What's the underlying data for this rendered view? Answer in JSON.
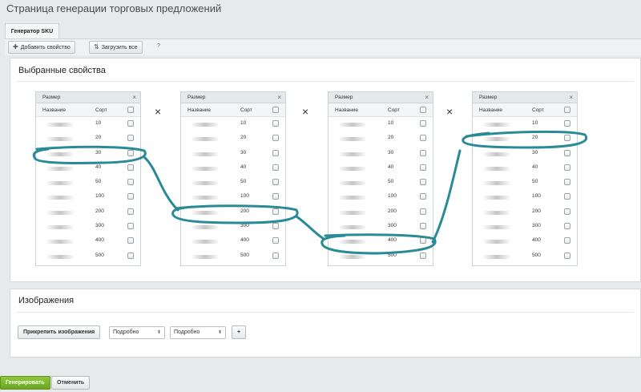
{
  "page_title": "Страница генерации торговых предложений",
  "tab_label": "Генератор SKU",
  "toolbar": {
    "add_label": "Добавить свойство",
    "load_label": "Загрузить все",
    "help_label": "?"
  },
  "selected": {
    "title": "Выбранные свойства"
  },
  "properties": [
    {
      "header": "Размер",
      "col_name": "Название",
      "col_sort": "Сорт",
      "values": [
        "10",
        "20",
        "30",
        "40",
        "50",
        "100",
        "200",
        "300",
        "400",
        "500"
      ]
    },
    {
      "header": "Размер",
      "col_name": "Название",
      "col_sort": "Сорт",
      "values": [
        "10",
        "20",
        "30",
        "40",
        "50",
        "100",
        "200",
        "300",
        "400",
        "500"
      ]
    },
    {
      "header": "Размер",
      "col_name": "Название",
      "col_sort": "Сорт",
      "values": [
        "10",
        "20",
        "30",
        "40",
        "50",
        "100",
        "200",
        "300",
        "400",
        "500"
      ]
    },
    {
      "header": "Размер",
      "col_name": "Название",
      "col_sort": "Сорт",
      "values": [
        "10",
        "20",
        "30",
        "40",
        "50",
        "100",
        "200",
        "300",
        "400",
        "500"
      ]
    }
  ],
  "times_symbol": "×",
  "close_symbol": "×",
  "images": {
    "title": "Изображения",
    "attach_label": "Прикрепить изображения",
    "select1": "Подробно",
    "select2": "Подробно",
    "plus": "+"
  },
  "footer": {
    "generate_label": "Генерировать",
    "cancel_label": "Отменить"
  },
  "colors": {
    "annotation": "#2a8a96",
    "generate": "#7ab52c"
  }
}
